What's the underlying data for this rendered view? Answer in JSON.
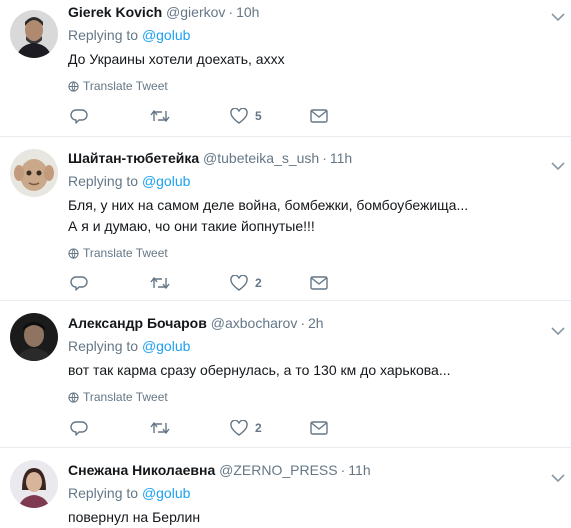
{
  "replying_label": "Replying to",
  "translate_label": "Translate Tweet",
  "icons": {
    "reply": "reply-icon",
    "retweet": "retweet-icon",
    "like": "heart-icon",
    "dm": "envelope-icon",
    "caret": "chevron-down-icon",
    "globe": "globe-icon"
  },
  "colors": {
    "link": "#1da1f2",
    "muted": "#657786",
    "text": "#14171a",
    "border": "#e6ecf0"
  },
  "tweets": [
    {
      "name": "Gierek Kovich",
      "handle": "@gierkov",
      "time": "10h",
      "reply_to": "@golub",
      "text": "До Украины хотели доехать, ахxх",
      "likes": "5",
      "translate": true
    },
    {
      "name": "Шайтан-тюбетейка",
      "handle": "@tubeteika_s_ush",
      "time": "11h",
      "reply_to": "@golub",
      "text_lines": [
        "Бля, у них на самом деле война, бомбежки, бомбоубежища...",
        "А я и думаю, чо они такие йопнутые!!!"
      ],
      "likes": "2",
      "translate": true
    },
    {
      "name": "Александр Бочаров",
      "handle": "@axbocharov",
      "time": "2h",
      "reply_to": "@golub",
      "text": "вот так карма сразу обернулась, а то 130 км до харькова...",
      "likes": "2",
      "translate": true
    },
    {
      "name": "Снежана Николаевна",
      "handle": "@ZERNO_PRESS",
      "time": "11h",
      "reply_to": "@golub",
      "text": "повернул на Берлин"
    }
  ]
}
